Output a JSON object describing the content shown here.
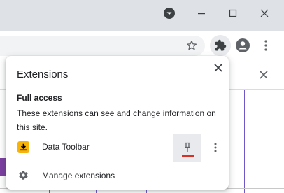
{
  "window": {
    "controls": [
      {
        "name": "profile-dropdown-icon"
      },
      {
        "name": "minimize-icon"
      },
      {
        "name": "maximize-icon"
      },
      {
        "name": "close-icon"
      }
    ]
  },
  "toolbar": {
    "icons": [
      "star-icon",
      "puzzle-icon",
      "account-icon",
      "more-vert-icon"
    ]
  },
  "extensions_popup": {
    "title": "Extensions",
    "section_heading": "Full access",
    "section_description": "These extensions can see and change information on this site.",
    "extensions": [
      {
        "name": "Data Toolbar",
        "icon": "download-box-icon",
        "pinned": false
      }
    ],
    "manage_label": "Manage extensions"
  },
  "colors": {
    "titlebar": "#dee1e6",
    "accent_pin_underline": "#d93025",
    "extension_icon": "#f8b30a",
    "page_lines": "#6f56c9"
  }
}
